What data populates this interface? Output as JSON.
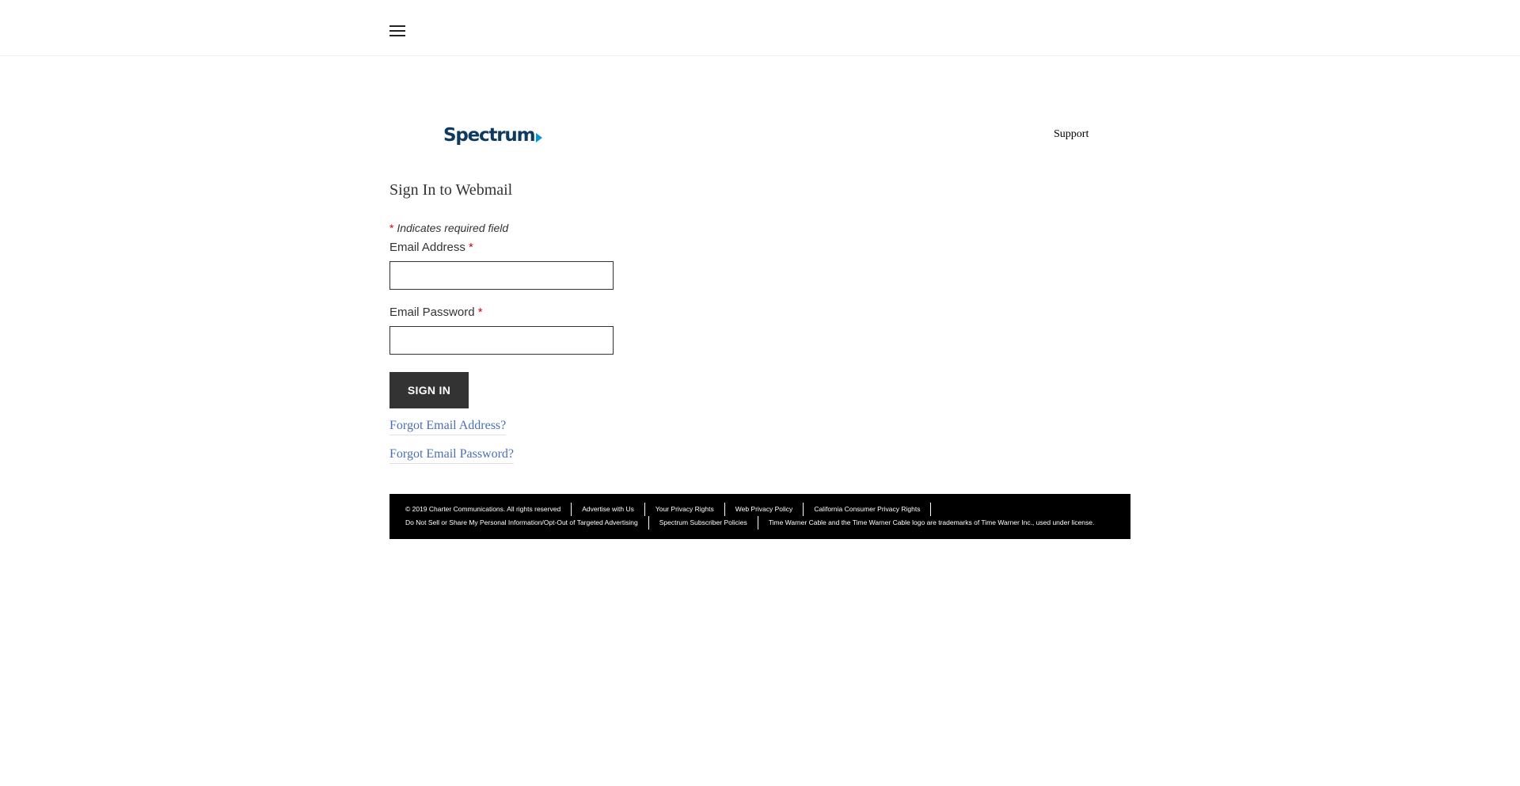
{
  "header": {
    "menu_icon": "hamburger-menu-icon"
  },
  "brand": {
    "logo_text": "Spectrum",
    "logo_color": "#0e3a5f",
    "arrow_color": "#0099d8"
  },
  "nav": {
    "support_label": "Support"
  },
  "form": {
    "title": "Sign In to Webmail",
    "required_star": "*",
    "required_note": "Indicates required field",
    "email_label": "Email Address",
    "email_value": "",
    "password_label": "Email Password",
    "password_value": "",
    "signin_label": "SIGN IN",
    "forgot_email": "Forgot Email Address?",
    "forgot_password": "Forgot Email Password?"
  },
  "footer": {
    "row1": [
      "© 2019 Charter Communications. All rights reserved",
      "Advertise with Us",
      "Your Privacy Rights",
      "Web Privacy Policy",
      "California Consumer Privacy Rights"
    ],
    "row2": [
      "Do Not Sell or Share My Personal Information/Opt-Out of Targeted Advertising",
      "Spectrum Subscriber Policies",
      "Time Warner Cable and the Time Warner Cable logo are trademarks of Time Warner Inc., used under license."
    ]
  },
  "colors": {
    "link": "#4a6fb5",
    "required": "#d0021b",
    "button_bg": "#333333",
    "footer_bg": "#000000"
  }
}
